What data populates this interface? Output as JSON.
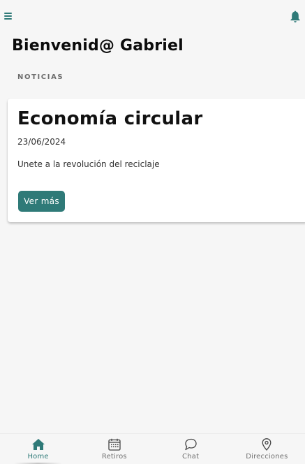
{
  "header": {
    "menu_icon": "hamburger-menu-icon",
    "notification_icon": "bell-icon"
  },
  "page": {
    "title": "Bienvenid@ Gabriel",
    "section_label": "NOTICIAS"
  },
  "news": [
    {
      "title": "Economía circular",
      "date": "23/06/2024",
      "description": "Unete a la revolución del reciclaje",
      "button_label": "Ver más"
    }
  ],
  "bottom_nav": {
    "active": "Home",
    "items": [
      {
        "label": "Home",
        "icon": "home-icon"
      },
      {
        "label": "Retiros",
        "icon": "calendar-icon"
      },
      {
        "label": "Chat",
        "icon": "chat-bubble-icon"
      },
      {
        "label": "Direcciones",
        "icon": "location-pin-icon"
      }
    ]
  },
  "colors": {
    "accent": "#2f7a78",
    "background": "#f6f6f6",
    "card": "#ffffff"
  }
}
